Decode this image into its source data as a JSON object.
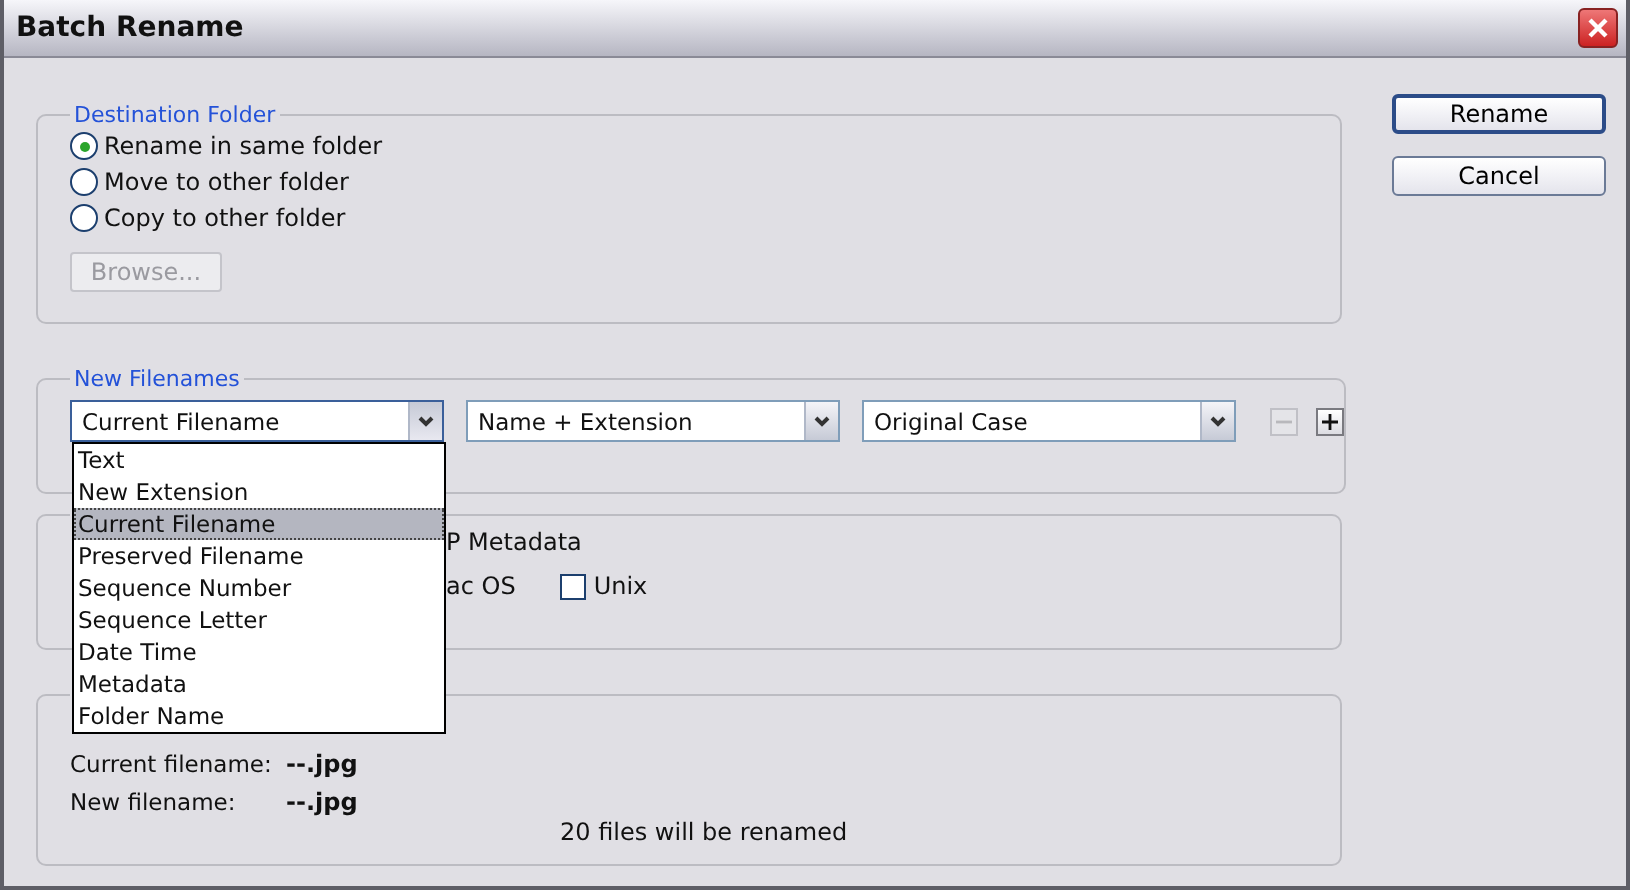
{
  "window": {
    "title": "Batch Rename"
  },
  "buttons": [
    {
      "label": "Rename",
      "default": true
    },
    {
      "label": "Cancel",
      "default": false
    }
  ],
  "destination_folder": {
    "title": "Destination Folder",
    "options": [
      {
        "label": "Rename in same folder",
        "selected": true
      },
      {
        "label": "Move to other folder",
        "selected": false
      },
      {
        "label": "Copy to other folder",
        "selected": false
      }
    ],
    "browse": {
      "label": "Browse...",
      "disabled": true
    }
  },
  "new_filenames": {
    "title": "New Filenames",
    "dropdowns": [
      {
        "value": "Current Filename",
        "expanded": true,
        "items": [
          {
            "label": "Text",
            "selected": false
          },
          {
            "label": "New Extension",
            "selected": false
          },
          {
            "label": "Current Filename",
            "selected": true
          },
          {
            "label": "Preserved Filename",
            "selected": false
          },
          {
            "label": "Sequence Number",
            "selected": false
          },
          {
            "label": "Sequence Letter",
            "selected": false
          },
          {
            "label": "Date Time",
            "selected": false
          },
          {
            "label": "Metadata",
            "selected": false
          },
          {
            "label": "Folder Name",
            "selected": false
          }
        ]
      },
      {
        "value": "Name + Extension",
        "expanded": false
      },
      {
        "value": "Original Case",
        "expanded": false
      }
    ],
    "row_buttons": [
      {
        "kind": "remove",
        "disabled": true
      },
      {
        "kind": "add",
        "disabled": false
      }
    ]
  },
  "options_panel": {
    "metadata_label": "P Metadata",
    "compat_label": "ac OS",
    "unix": {
      "label": "Unix",
      "checked": false
    }
  },
  "preview": {
    "rows": [
      {
        "label": "Current filename:",
        "value": "--.jpg"
      },
      {
        "label": "New filename:",
        "value": "--.jpg"
      }
    ],
    "summary": "20 files will be renamed"
  }
}
